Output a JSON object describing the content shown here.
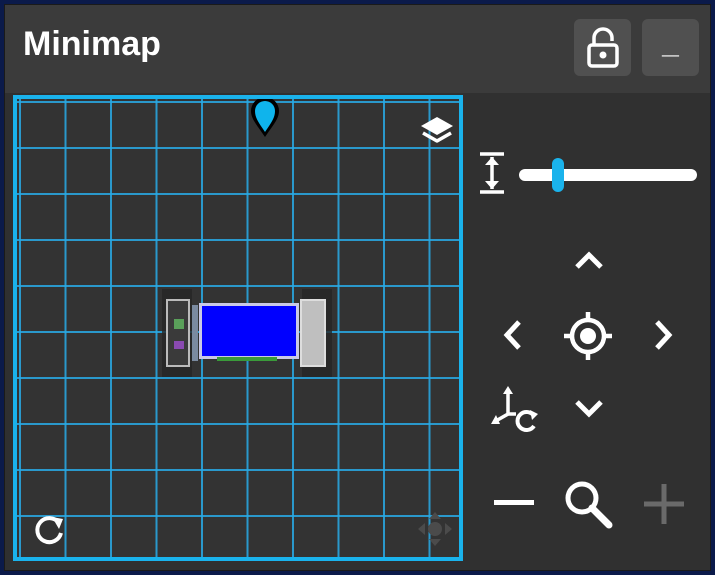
{
  "window": {
    "title": "Minimap"
  },
  "titlebar": {
    "lock_icon": "unlock-icon",
    "minimize_label": "_"
  },
  "map": {
    "marker_color": "#0fb4ec",
    "grid_color": "#1ab3ec",
    "vehicle_color": "#0000ff",
    "icons": [
      "layers-icon",
      "reset-rotation-icon",
      "pan-move-icon",
      "location-pin-icon"
    ]
  },
  "controls": {
    "height_slider": {
      "value": 0.22
    },
    "icons": [
      "height-icon",
      "chevron-up-icon",
      "chevron-left-icon",
      "crosshair-icon",
      "chevron-right-icon",
      "chevron-down-icon",
      "rotate-axes-icon",
      "zoom-out-icon",
      "zoom-icon",
      "zoom-in-icon"
    ]
  }
}
